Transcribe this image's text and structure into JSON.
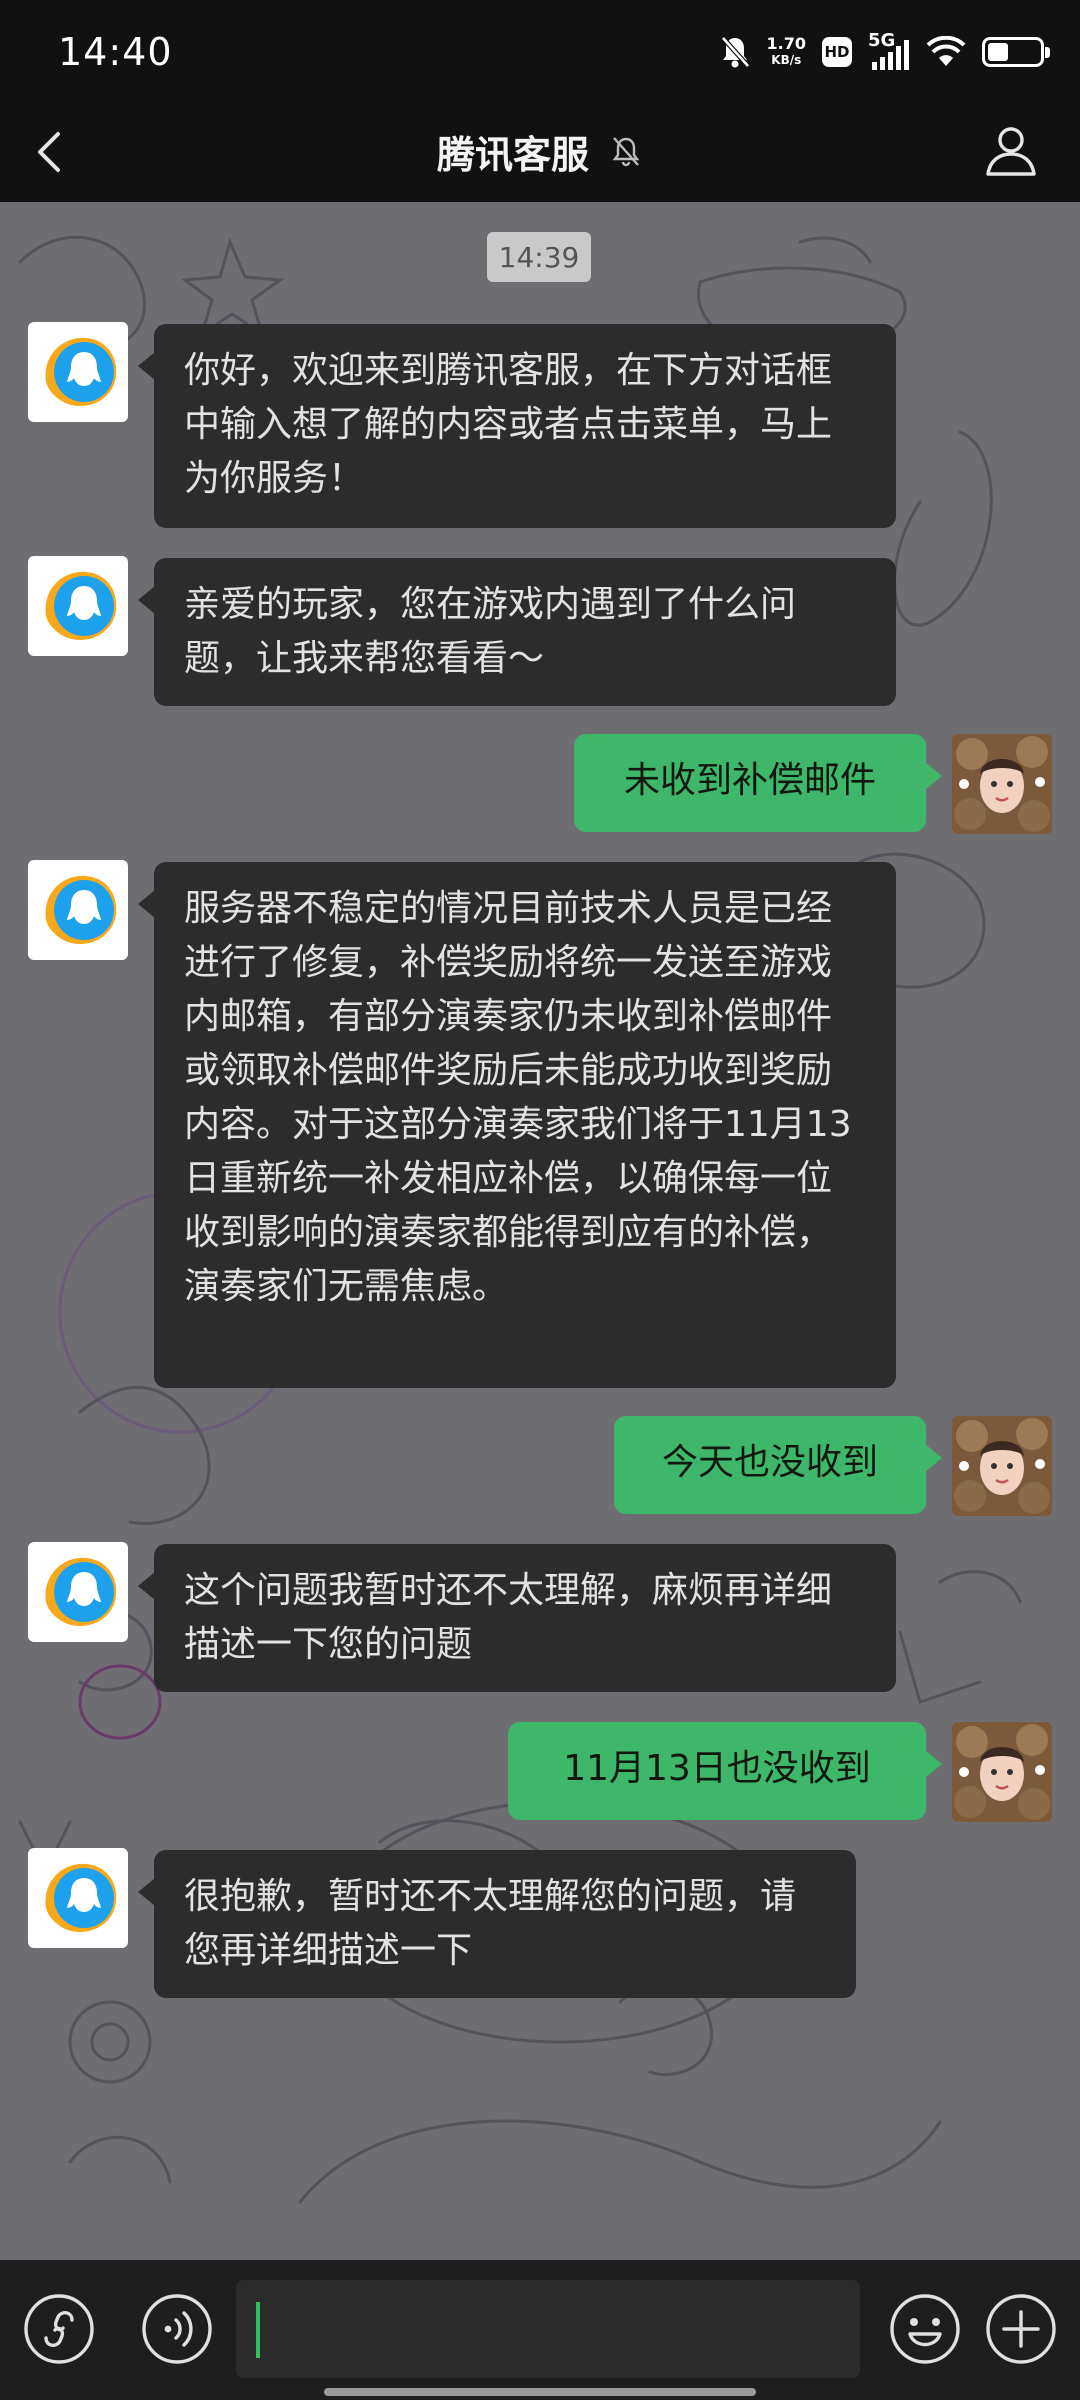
{
  "status_bar": {
    "time": "14:40",
    "net_speed_value": "1.70",
    "net_speed_unit": "KB/s",
    "hd_label": "HD",
    "network_label": "5G"
  },
  "header": {
    "title": "腾讯客服"
  },
  "chat": {
    "timestamp": "14:39",
    "messages": [
      {
        "from": "service",
        "text": "你好，欢迎来到腾讯客服，在下方对话框中输入想了解的内容或者点击菜单，马上为你服务！"
      },
      {
        "from": "service",
        "text": "亲爱的玩家，您在游戏内遇到了什么问题，让我来帮您看看～"
      },
      {
        "from": "user",
        "text": "未收到补偿邮件"
      },
      {
        "from": "service",
        "text": "服务器不稳定的情况目前技术人员是已经进行了修复，补偿奖励将统一发送至游戏内邮箱，有部分演奏家仍未收到补偿邮件或领取补偿邮件奖励后未能成功收到奖励内容。对于这部分演奏家我们将于11月13日重新统一补发相应补偿，以确保每一位收到影响的演奏家都能得到应有的补偿，演奏家们无需焦虑。"
      },
      {
        "from": "user",
        "text": "今天也没收到"
      },
      {
        "from": "service",
        "text": "这个问题我暂时还不太理解，麻烦再详细描述一下您的问题"
      },
      {
        "from": "user",
        "text": "11月13日也没收到"
      },
      {
        "from": "service",
        "text": "很抱歉，暂时还不太理解您的问题，请您再详细描述一下"
      }
    ]
  },
  "input_bar": {
    "input_value": "",
    "icons": [
      "mini-program-icon",
      "voice-icon",
      "emoji-icon",
      "plus-icon"
    ]
  },
  "colors": {
    "outgoing_bubble": "#3fb76b",
    "incoming_bubble": "#2c2c2c",
    "chat_background": "#6e6d72",
    "bars": "#111111"
  }
}
